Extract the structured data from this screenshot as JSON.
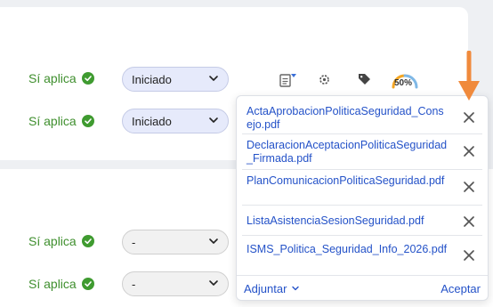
{
  "rows": [
    {
      "status": "Sí aplica",
      "select": "Iniciado"
    },
    {
      "status": "Sí aplica",
      "select": "Iniciado"
    },
    {
      "status": "Sí aplica",
      "select": "-"
    },
    {
      "status": "Sí aplica",
      "select": "-"
    }
  ],
  "toolbar": {
    "progress_label": "50%",
    "progress_value": 0.5,
    "icons": [
      "document-icon",
      "settings-icon",
      "tag-icon",
      "progress-gauge-icon"
    ]
  },
  "attachments": {
    "files": [
      "ActaAprobacionPoliticaSeguridad_Consejo.pdf",
      "DeclaracionAceptacionPoliticaSeguridad_Firmada.pdf",
      "PlanComunicacionPoliticaSeguridad.pdf",
      "ListaAsistenciaSesionSeguridad.pdf",
      "ISMS_Politica_Seguridad_Info_2026.pdf"
    ],
    "attach_label": "Adjuntar",
    "accept_label": "Aceptar"
  },
  "colors": {
    "accent_blue": "#2452c8",
    "status_green": "#3f8f2e",
    "arrow_orange": "#f08a3c",
    "progress_orange": "#f5a623",
    "progress_blue": "#7fb8e6"
  }
}
